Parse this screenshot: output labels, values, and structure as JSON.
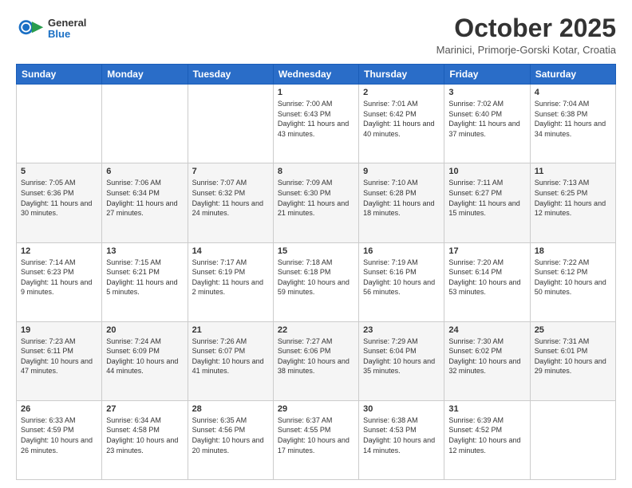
{
  "logo": {
    "general": "General",
    "blue": "Blue"
  },
  "title": "October 2025",
  "location": "Marinici, Primorje-Gorski Kotar, Croatia",
  "days_of_week": [
    "Sunday",
    "Monday",
    "Tuesday",
    "Wednesday",
    "Thursday",
    "Friday",
    "Saturday"
  ],
  "weeks": [
    [
      {
        "day": "",
        "sunrise": "",
        "sunset": "",
        "daylight": ""
      },
      {
        "day": "",
        "sunrise": "",
        "sunset": "",
        "daylight": ""
      },
      {
        "day": "",
        "sunrise": "",
        "sunset": "",
        "daylight": ""
      },
      {
        "day": "1",
        "sunrise": "Sunrise: 7:00 AM",
        "sunset": "Sunset: 6:43 PM",
        "daylight": "Daylight: 11 hours and 43 minutes."
      },
      {
        "day": "2",
        "sunrise": "Sunrise: 7:01 AM",
        "sunset": "Sunset: 6:42 PM",
        "daylight": "Daylight: 11 hours and 40 minutes."
      },
      {
        "day": "3",
        "sunrise": "Sunrise: 7:02 AM",
        "sunset": "Sunset: 6:40 PM",
        "daylight": "Daylight: 11 hours and 37 minutes."
      },
      {
        "day": "4",
        "sunrise": "Sunrise: 7:04 AM",
        "sunset": "Sunset: 6:38 PM",
        "daylight": "Daylight: 11 hours and 34 minutes."
      }
    ],
    [
      {
        "day": "5",
        "sunrise": "Sunrise: 7:05 AM",
        "sunset": "Sunset: 6:36 PM",
        "daylight": "Daylight: 11 hours and 30 minutes."
      },
      {
        "day": "6",
        "sunrise": "Sunrise: 7:06 AM",
        "sunset": "Sunset: 6:34 PM",
        "daylight": "Daylight: 11 hours and 27 minutes."
      },
      {
        "day": "7",
        "sunrise": "Sunrise: 7:07 AM",
        "sunset": "Sunset: 6:32 PM",
        "daylight": "Daylight: 11 hours and 24 minutes."
      },
      {
        "day": "8",
        "sunrise": "Sunrise: 7:09 AM",
        "sunset": "Sunset: 6:30 PM",
        "daylight": "Daylight: 11 hours and 21 minutes."
      },
      {
        "day": "9",
        "sunrise": "Sunrise: 7:10 AM",
        "sunset": "Sunset: 6:28 PM",
        "daylight": "Daylight: 11 hours and 18 minutes."
      },
      {
        "day": "10",
        "sunrise": "Sunrise: 7:11 AM",
        "sunset": "Sunset: 6:27 PM",
        "daylight": "Daylight: 11 hours and 15 minutes."
      },
      {
        "day": "11",
        "sunrise": "Sunrise: 7:13 AM",
        "sunset": "Sunset: 6:25 PM",
        "daylight": "Daylight: 11 hours and 12 minutes."
      }
    ],
    [
      {
        "day": "12",
        "sunrise": "Sunrise: 7:14 AM",
        "sunset": "Sunset: 6:23 PM",
        "daylight": "Daylight: 11 hours and 9 minutes."
      },
      {
        "day": "13",
        "sunrise": "Sunrise: 7:15 AM",
        "sunset": "Sunset: 6:21 PM",
        "daylight": "Daylight: 11 hours and 5 minutes."
      },
      {
        "day": "14",
        "sunrise": "Sunrise: 7:17 AM",
        "sunset": "Sunset: 6:19 PM",
        "daylight": "Daylight: 11 hours and 2 minutes."
      },
      {
        "day": "15",
        "sunrise": "Sunrise: 7:18 AM",
        "sunset": "Sunset: 6:18 PM",
        "daylight": "Daylight: 10 hours and 59 minutes."
      },
      {
        "day": "16",
        "sunrise": "Sunrise: 7:19 AM",
        "sunset": "Sunset: 6:16 PM",
        "daylight": "Daylight: 10 hours and 56 minutes."
      },
      {
        "day": "17",
        "sunrise": "Sunrise: 7:20 AM",
        "sunset": "Sunset: 6:14 PM",
        "daylight": "Daylight: 10 hours and 53 minutes."
      },
      {
        "day": "18",
        "sunrise": "Sunrise: 7:22 AM",
        "sunset": "Sunset: 6:12 PM",
        "daylight": "Daylight: 10 hours and 50 minutes."
      }
    ],
    [
      {
        "day": "19",
        "sunrise": "Sunrise: 7:23 AM",
        "sunset": "Sunset: 6:11 PM",
        "daylight": "Daylight: 10 hours and 47 minutes."
      },
      {
        "day": "20",
        "sunrise": "Sunrise: 7:24 AM",
        "sunset": "Sunset: 6:09 PM",
        "daylight": "Daylight: 10 hours and 44 minutes."
      },
      {
        "day": "21",
        "sunrise": "Sunrise: 7:26 AM",
        "sunset": "Sunset: 6:07 PM",
        "daylight": "Daylight: 10 hours and 41 minutes."
      },
      {
        "day": "22",
        "sunrise": "Sunrise: 7:27 AM",
        "sunset": "Sunset: 6:06 PM",
        "daylight": "Daylight: 10 hours and 38 minutes."
      },
      {
        "day": "23",
        "sunrise": "Sunrise: 7:29 AM",
        "sunset": "Sunset: 6:04 PM",
        "daylight": "Daylight: 10 hours and 35 minutes."
      },
      {
        "day": "24",
        "sunrise": "Sunrise: 7:30 AM",
        "sunset": "Sunset: 6:02 PM",
        "daylight": "Daylight: 10 hours and 32 minutes."
      },
      {
        "day": "25",
        "sunrise": "Sunrise: 7:31 AM",
        "sunset": "Sunset: 6:01 PM",
        "daylight": "Daylight: 10 hours and 29 minutes."
      }
    ],
    [
      {
        "day": "26",
        "sunrise": "Sunrise: 6:33 AM",
        "sunset": "Sunset: 4:59 PM",
        "daylight": "Daylight: 10 hours and 26 minutes."
      },
      {
        "day": "27",
        "sunrise": "Sunrise: 6:34 AM",
        "sunset": "Sunset: 4:58 PM",
        "daylight": "Daylight: 10 hours and 23 minutes."
      },
      {
        "day": "28",
        "sunrise": "Sunrise: 6:35 AM",
        "sunset": "Sunset: 4:56 PM",
        "daylight": "Daylight: 10 hours and 20 minutes."
      },
      {
        "day": "29",
        "sunrise": "Sunrise: 6:37 AM",
        "sunset": "Sunset: 4:55 PM",
        "daylight": "Daylight: 10 hours and 17 minutes."
      },
      {
        "day": "30",
        "sunrise": "Sunrise: 6:38 AM",
        "sunset": "Sunset: 4:53 PM",
        "daylight": "Daylight: 10 hours and 14 minutes."
      },
      {
        "day": "31",
        "sunrise": "Sunrise: 6:39 AM",
        "sunset": "Sunset: 4:52 PM",
        "daylight": "Daylight: 10 hours and 12 minutes."
      },
      {
        "day": "",
        "sunrise": "",
        "sunset": "",
        "daylight": ""
      }
    ]
  ]
}
